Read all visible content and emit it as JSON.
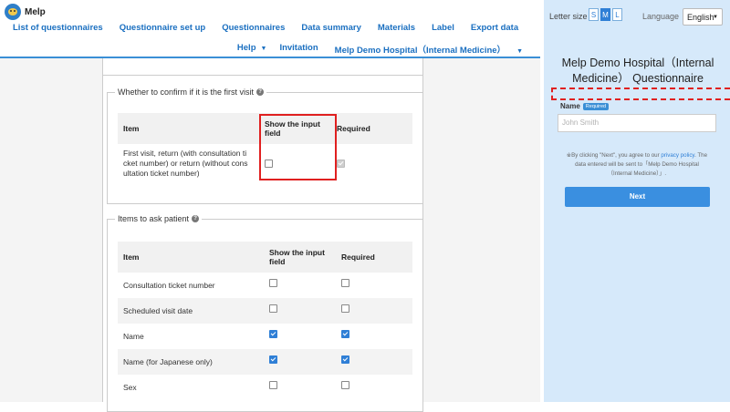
{
  "app": {
    "name": "Melp"
  },
  "nav": {
    "row1": [
      "List of questionnaires",
      "Questionnaire set up",
      "Questionnaires",
      "Data summary",
      "Materials",
      "Label",
      "Export data"
    ],
    "help": "Help",
    "invitation": "Invitation",
    "hospital": "Melp Demo Hospital（Internal Medicine）"
  },
  "first_visit_section": {
    "legend": "Whether to confirm if it is the first visit",
    "headers": {
      "item": "Item",
      "show": "Show the input field",
      "required": "Required"
    },
    "row": {
      "lines": [
        "First visit, return (with consultation ti",
        "cket number) or return (without cons",
        "ultation ticket number)"
      ],
      "show_checked": false,
      "required_checked": true,
      "required_disabled": true
    }
  },
  "ask_section": {
    "legend": "Items to ask patient",
    "headers": {
      "item": "Item",
      "show": "Show the input field",
      "required": "Required"
    },
    "rows": [
      {
        "label": "Consultation ticket number",
        "show": false,
        "required": false
      },
      {
        "label": "Scheduled visit date",
        "show": false,
        "required": false
      },
      {
        "label": "Name",
        "show": true,
        "required": true
      },
      {
        "label": "Name (for Japanese only)",
        "show": true,
        "required": true
      },
      {
        "label": "Sex",
        "show": false,
        "required": false
      }
    ]
  },
  "preview": {
    "letter_size_label": "Letter size",
    "sizes": [
      "S",
      "M",
      "L"
    ],
    "active_size": "M",
    "language_label": "Language",
    "language_value": "English",
    "title": "Melp Demo Hospital（Internal Medicine） Questionnaire",
    "name_label": "Name",
    "required_badge": "Required",
    "name_placeholder": "John Smith",
    "consent_prefix": "※By clicking \"Next\", you agree to our ",
    "consent_link": "privacy policy",
    "consent_suffix": ". The data entered will be sent to「Melp Demo Hospital（Internal Medicine）」.",
    "next_button": "Next"
  },
  "colors": {
    "accent": "#2f7fd6",
    "highlight": "#e02020",
    "preview_bg": "#d6e9fa"
  }
}
